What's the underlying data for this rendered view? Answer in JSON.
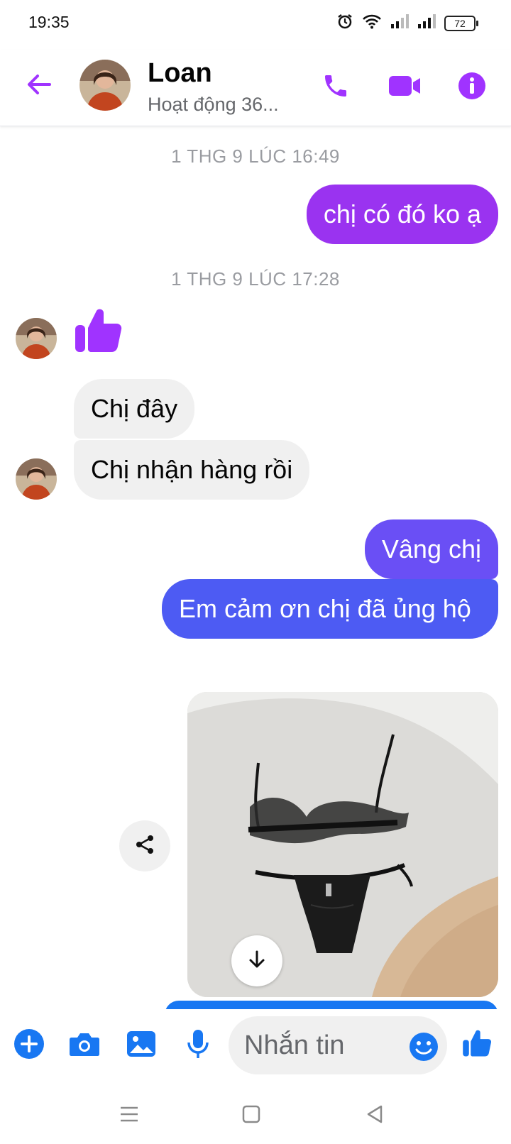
{
  "status_bar": {
    "time": "19:35",
    "battery": "72",
    "icons": [
      "alarm-icon",
      "wifi-icon",
      "signal-icon",
      "signal-icon",
      "battery-icon"
    ]
  },
  "header": {
    "name": "Loan",
    "status": "Hoạt động 36...",
    "icons": [
      "back-arrow-icon",
      "phone-icon",
      "video-icon",
      "info-icon"
    ],
    "accent_color": "#a033ff"
  },
  "conversation": {
    "timestamps": [
      "1 THG 9 LÚC 16:49",
      "1 THG 9 LÚC 17:28"
    ],
    "messages": [
      {
        "sender": "me",
        "text": "chị có đó ko ạ"
      },
      {
        "sender": "Loan",
        "type": "like",
        "icon": "thumbs-up-icon"
      },
      {
        "sender": "Loan",
        "text": "Chị đây"
      },
      {
        "sender": "Loan",
        "text": "Chị nhận hàng rồi"
      },
      {
        "sender": "me",
        "text": "Vâng chị"
      },
      {
        "sender": "me",
        "text": "Em cảm ơn chị đã ủng hộ"
      },
      {
        "sender": "me",
        "type": "image",
        "icons": [
          "share-icon",
          "download-icon"
        ]
      }
    ],
    "bubble_colors": {
      "outgoing_purple": "#9a33f0",
      "outgoing_blue": "#4d5bf3",
      "incoming": "#f0f0f0"
    }
  },
  "composer": {
    "placeholder": "Nhắn tin",
    "icons": [
      "plus-icon",
      "camera-icon",
      "gallery-icon",
      "microphone-icon",
      "emoji-icon",
      "thumbs-up-icon"
    ],
    "accent_color": "#1877f2"
  },
  "nav_bar": {
    "icons": [
      "menu-icon",
      "home-icon",
      "back-icon"
    ]
  }
}
